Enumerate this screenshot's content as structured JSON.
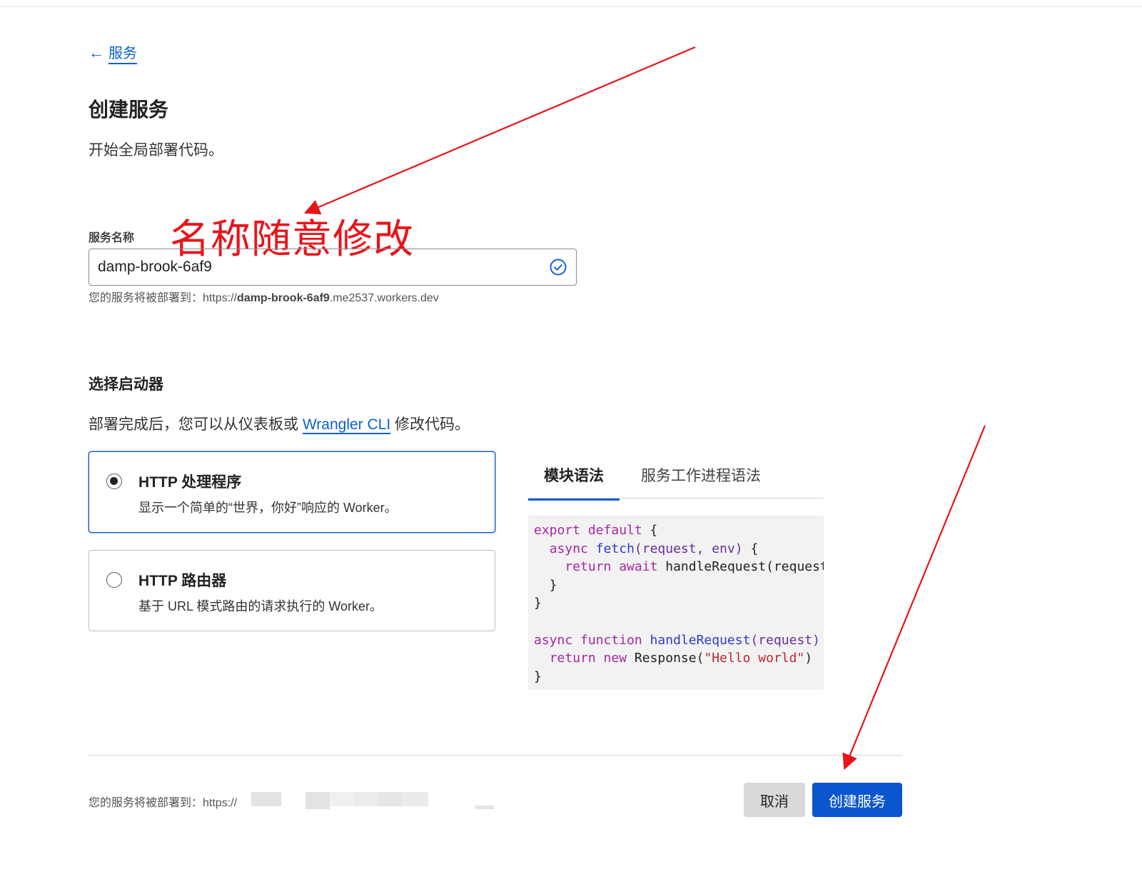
{
  "nav": {
    "back_label": "服务"
  },
  "header": {
    "title": "创建服务",
    "subtitle": "开始全局部署代码。"
  },
  "name_field": {
    "label": "服务名称",
    "value": "damp-brook-6af9",
    "hint_prefix": "您的服务将被部署到：https://",
    "hint_name": "damp-brook-6af9",
    "hint_suffix": ".me2537.workers.dev"
  },
  "annotation": {
    "text": "名称随意修改",
    "color": "#e8141a"
  },
  "starter": {
    "title": "选择启动器",
    "desc_prefix": "部署完成后，您可以从仪表板或 ",
    "desc_link": "Wrangler CLI",
    "desc_suffix": " 修改代码。",
    "options": [
      {
        "title": "HTTP 处理程序",
        "desc": "显示一个简单的“世界，你好”响应的 Worker。",
        "selected": true
      },
      {
        "title": "HTTP 路由器",
        "desc": "基于 URL 模式路由的请求执行的 Worker。",
        "selected": false
      }
    ]
  },
  "code_tabs": [
    "模块语法",
    "服务工作进程语法"
  ],
  "code": {
    "l1_kw": "export default",
    "l1_rest": " {",
    "l2_kw": "async",
    "l2_fn": "fetch",
    "l2_params": "(request, env)",
    "l2_rest": " {",
    "l3_kw": "return await",
    "l3_rest": " handleRequest(request)",
    "l4": "  }",
    "l5": "}",
    "l7_kw": "async function",
    "l7_fn": "handleRequest",
    "l7_params": "(request)",
    "l7_rest": " {",
    "l8_kw": "return new",
    "l8_mid": " Response(",
    "l8_str": "\"Hello world\"",
    "l8_end": ")",
    "l9": "}"
  },
  "footer": {
    "hint": "您的服务将被部署到：https://"
  },
  "buttons": {
    "cancel": "取消",
    "create": "创建服务"
  },
  "colors": {
    "accent": "#0b55cf",
    "annotation_red": "#e8141a"
  }
}
